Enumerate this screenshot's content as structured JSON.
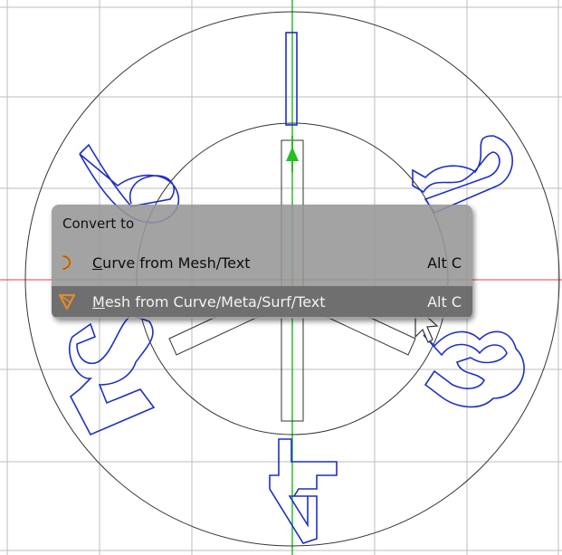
{
  "menu": {
    "title": "Convert to",
    "items": [
      {
        "label": "Curve from Mesh/Text",
        "mnemonic": "C",
        "rest": "urve from Mesh/Text",
        "shortcut": "Alt C",
        "icon": "curve-icon",
        "highlighted": false
      },
      {
        "label": "Mesh from Curve/Meta/Surf/Text",
        "mnemonic": "M",
        "rest": "esh from Curve/Meta/Surf/Text",
        "shortcut": "Alt C",
        "icon": "mesh-icon",
        "highlighted": true
      }
    ]
  },
  "viewport": {
    "background": "#ffffff",
    "grid_color": "#bdbdbd",
    "x_axis_color": "#e04444",
    "y_axis_color": "#22c022",
    "outline_color": "#1f2fc4",
    "object_color": "#333333",
    "numerals": [
      "1",
      "2",
      "3",
      "4",
      "5",
      "6"
    ]
  },
  "colors": {
    "menu_bg": "#969696",
    "menu_highlight": "#6f6f6f",
    "icon_orange": "#e58a2b"
  }
}
